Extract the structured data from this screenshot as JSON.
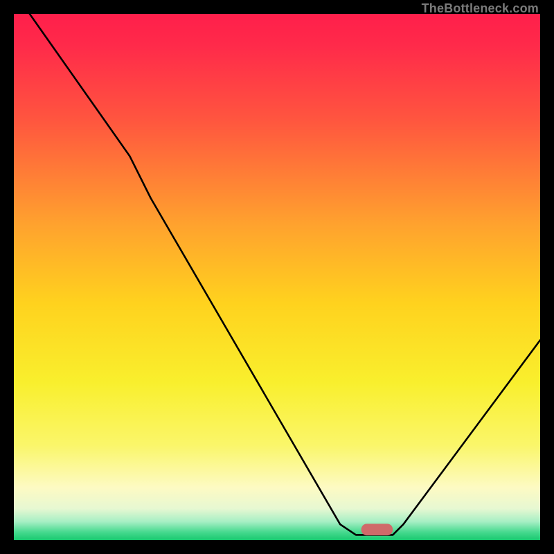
{
  "watermark": "TheBottleneck.com",
  "chart_data": {
    "type": "line",
    "title": "",
    "xlabel": "",
    "ylabel": "",
    "xlim": [
      0,
      100
    ],
    "ylim": [
      0,
      100
    ],
    "grid": false,
    "series": [
      {
        "name": "curve",
        "color": "#000000",
        "points": [
          {
            "x": 3,
            "y": 100
          },
          {
            "x": 22,
            "y": 73
          },
          {
            "x": 26,
            "y": 65
          },
          {
            "x": 62,
            "y": 3
          },
          {
            "x": 65,
            "y": 1
          },
          {
            "x": 72,
            "y": 1
          },
          {
            "x": 74,
            "y": 3
          },
          {
            "x": 100,
            "y": 38
          }
        ]
      }
    ],
    "optimal_marker": {
      "x": 69,
      "y": 2,
      "width_pct": 6,
      "height_pct": 2.2,
      "color": "#cf6a6a"
    },
    "gradient_stops": [
      {
        "offset": 0.0,
        "color": "#ff1f4b"
      },
      {
        "offset": 0.06,
        "color": "#ff2a4a"
      },
      {
        "offset": 0.2,
        "color": "#ff553f"
      },
      {
        "offset": 0.4,
        "color": "#ffa22e"
      },
      {
        "offset": 0.55,
        "color": "#ffd21e"
      },
      {
        "offset": 0.7,
        "color": "#f9ef2d"
      },
      {
        "offset": 0.82,
        "color": "#faf66a"
      },
      {
        "offset": 0.9,
        "color": "#fdfac3"
      },
      {
        "offset": 0.94,
        "color": "#e7f8d2"
      },
      {
        "offset": 0.965,
        "color": "#a6efc4"
      },
      {
        "offset": 0.985,
        "color": "#45d98e"
      },
      {
        "offset": 1.0,
        "color": "#18c96f"
      }
    ]
  }
}
